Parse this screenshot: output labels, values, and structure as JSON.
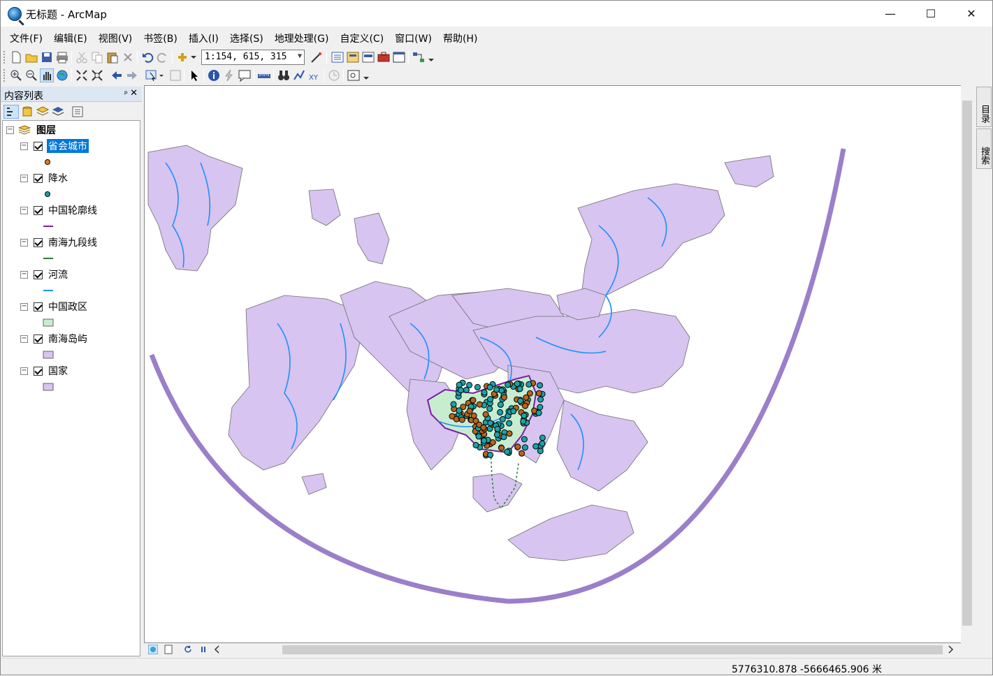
{
  "window": {
    "title": "无标题 - ArcMap",
    "minimize": "—",
    "maximize": "☐",
    "close": "✕"
  },
  "menu": [
    "文件(F)",
    "编辑(E)",
    "视图(V)",
    "书签(B)",
    "插入(I)",
    "选择(S)",
    "地理处理(G)",
    "自定义(C)",
    "窗口(W)",
    "帮助(H)"
  ],
  "standard_toolbar": {
    "scale_value": "1:154, 615, 315"
  },
  "toc": {
    "title": "内容列表",
    "root_label": "图层",
    "layers": [
      {
        "name": "省会城市",
        "symbol": "point",
        "color": "#e67e22",
        "checked": true,
        "selected": true
      },
      {
        "name": "降水",
        "symbol": "point",
        "color": "#1aa3a8",
        "checked": true,
        "selected": false
      },
      {
        "name": "中国轮廓线",
        "symbol": "line",
        "color": "#7b1fa2",
        "checked": true,
        "selected": false
      },
      {
        "name": "南海九段线",
        "symbol": "line",
        "color": "#2e7d32",
        "checked": true,
        "selected": false
      },
      {
        "name": "河流",
        "symbol": "line",
        "color": "#1e90ff",
        "checked": true,
        "selected": false
      },
      {
        "name": "中国政区",
        "symbol": "polygon",
        "color": "#c8ecd0",
        "checked": true,
        "selected": false
      },
      {
        "name": "南海岛屿",
        "symbol": "polygon",
        "color": "#d7c4f0",
        "checked": true,
        "selected": false
      },
      {
        "name": "国家",
        "symbol": "polygon",
        "color": "#d7c4f0",
        "checked": true,
        "selected": false
      }
    ]
  },
  "side_dock": {
    "catalog": "目录",
    "search": "搜索"
  },
  "status": {
    "coordinates": "5776310.878  -5666465.906 米"
  },
  "colors": {
    "land": "#d7c4f0",
    "land_border": "#6e6e6e",
    "river": "#1e90ff",
    "china": "#c8ecd0",
    "china_outline": "#7b1fa2",
    "city": "#b5651d",
    "precip": "#1aa3a8"
  }
}
